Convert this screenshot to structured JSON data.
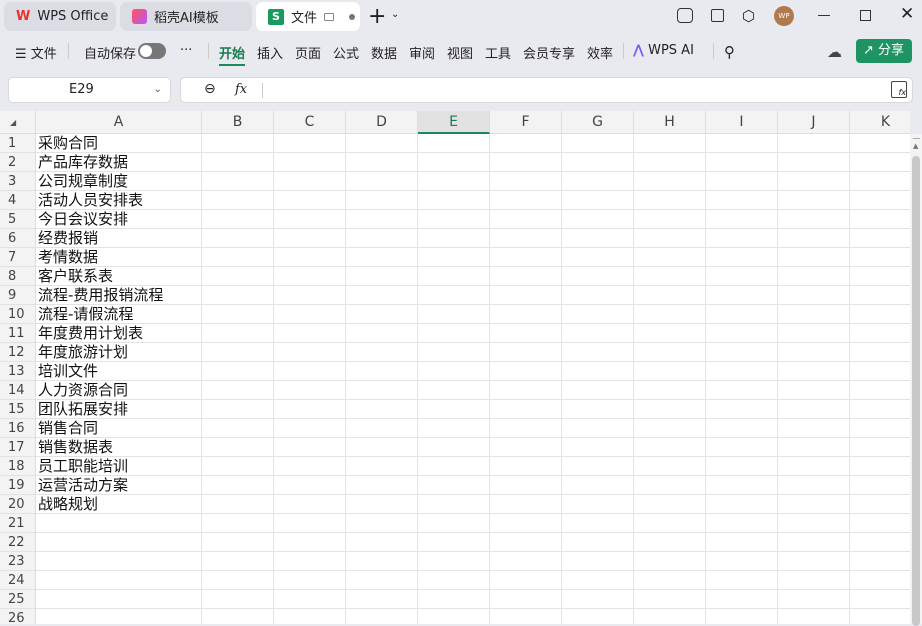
{
  "tabs": [
    {
      "label": "WPS Office",
      "icon": "wps-logo-icon"
    },
    {
      "label": "稻壳AI模板",
      "icon": "docer-icon"
    },
    {
      "label": "文件",
      "icon": "sheet-icon",
      "active": true
    }
  ],
  "toolbar": {
    "menu": "文件",
    "autosave": "自动保存",
    "more": "···",
    "items": [
      "开始",
      "插入",
      "页面",
      "公式",
      "数据",
      "审阅",
      "视图",
      "工具",
      "会员专享",
      "效率"
    ],
    "active": "开始",
    "wps_ai": "WPS AI",
    "share": "分享",
    "avatar": "WP"
  },
  "formula_bar": {
    "cell_ref": "E29",
    "fx": "fx",
    "value": ""
  },
  "columns": [
    "A",
    "B",
    "C",
    "D",
    "E",
    "F",
    "G",
    "H",
    "I",
    "J",
    "K"
  ],
  "selected_column": "E",
  "rows": [
    "1",
    "2",
    "3",
    "4",
    "5",
    "6",
    "7",
    "8",
    "9",
    "10",
    "11",
    "12",
    "13",
    "14",
    "15",
    "16",
    "17",
    "18",
    "19",
    "20",
    "21",
    "22",
    "23",
    "24",
    "25",
    "26"
  ],
  "cells_A": [
    "采购合同",
    "产品库存数据",
    "公司规章制度",
    "活动人员安排表",
    "今日会议安排",
    "经费报销",
    "考情数据",
    "客户联系表",
    "流程-费用报销流程",
    "流程-请假流程",
    "年度费用计划表",
    "年度旅游计划",
    "培训文件",
    "人力资源合同",
    "团队拓展安排",
    "销售合同",
    "销售数据表",
    "员工职能培训",
    "运营活动方案",
    "战略规划"
  ],
  "colors": {
    "accent": "#1a8a5a",
    "share": "#1d9461"
  }
}
